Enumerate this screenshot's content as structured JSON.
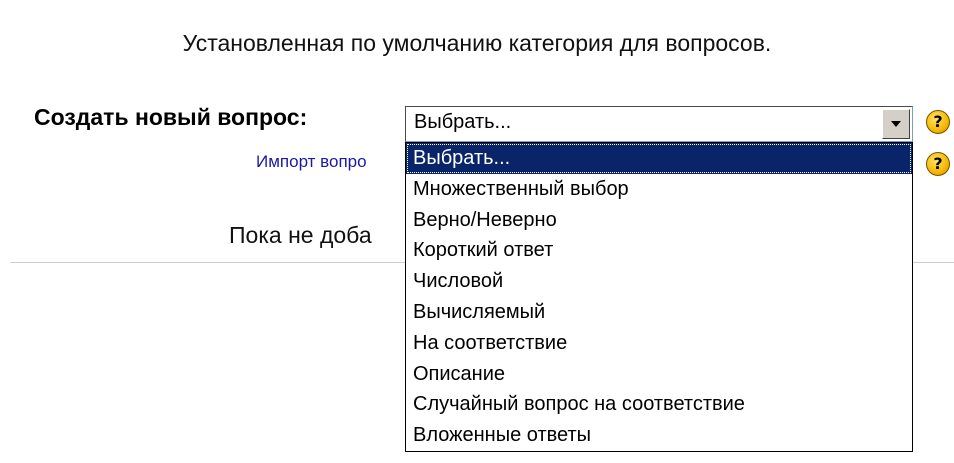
{
  "category": {
    "description": "Установленная по умолчанию категория для вопросов."
  },
  "create_question": {
    "label": "Создать новый вопрос:",
    "select": {
      "selected": "Выбрать...",
      "options": [
        "Выбрать...",
        "Множественный выбор",
        "Верно/Неверно",
        "Короткий ответ",
        "Числовой",
        "Вычисляемый",
        "На соответствие",
        "Описание",
        "Случайный вопрос на соответствие",
        "Вложенные ответы"
      ]
    },
    "help_glyph": "?"
  },
  "import": {
    "link_text": "Импорт вопро",
    "help_glyph": "?"
  },
  "status": {
    "empty_text": "Пока не доба"
  },
  "icons": {
    "help": "help-icon",
    "dropdown": "chevron-down-icon"
  },
  "colors": {
    "link": "#1a1aa6",
    "selection_bg": "#0a246a",
    "help_icon": "#f5b800"
  }
}
